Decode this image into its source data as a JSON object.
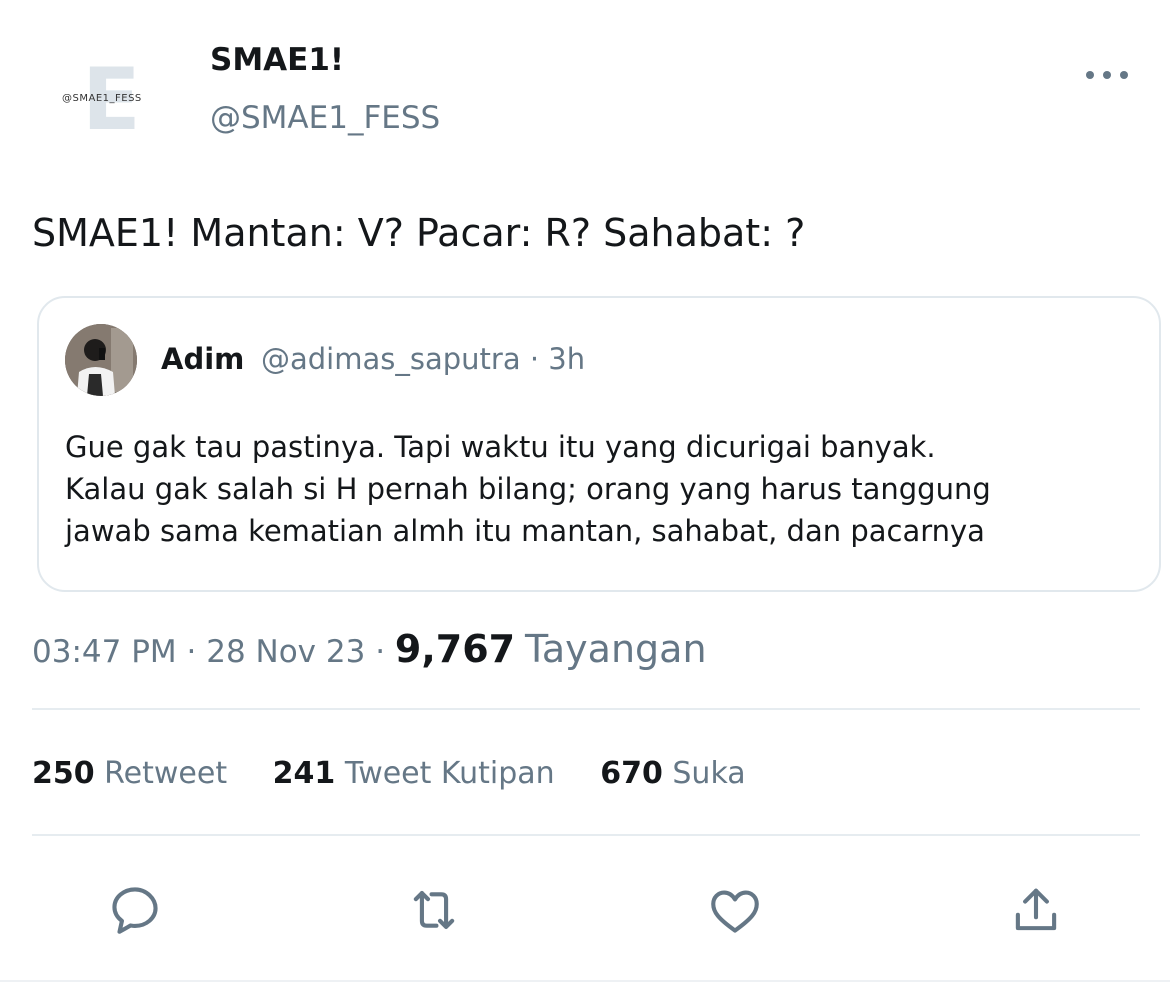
{
  "header": {
    "display_name": "SMAE1!",
    "handle": "@SMAE1_FESS",
    "logo_text": "@SMAE1_FESS",
    "logo_letter": "E"
  },
  "tweet": {
    "text": "SMAE1! Mantan: V? Pacar: R? Sahabat: ?"
  },
  "quote": {
    "name": "Adim",
    "handle_time": "@adimas_saputra · 3h",
    "lines": [
      "Gue gak tau pastinya. Tapi waktu itu yang dicurigai banyak.",
      "Kalau gak salah si H pernah bilang; orang yang harus tanggung",
      "jawab sama kematian almh itu mantan, sahabat, dan pacarnya"
    ]
  },
  "meta": {
    "time": "03:47 PM",
    "sep1": "·",
    "date": "28 Nov 23",
    "sep2": "·",
    "views_count": "9,767",
    "views_label": "Tayangan"
  },
  "stats": {
    "retweets_count": "250",
    "retweets_label": "Retweet",
    "quotes_count": "241",
    "quotes_label": "Tweet Kutipan",
    "likes_count": "670",
    "likes_label": "Suka"
  },
  "actions": {
    "icons": [
      "reply-icon",
      "retweet-icon",
      "like-icon",
      "share-icon"
    ]
  },
  "colors": {
    "text_primary": "#14171a",
    "text_secondary": "#657786",
    "border": "#e1e8ed",
    "icon": "#657786"
  }
}
